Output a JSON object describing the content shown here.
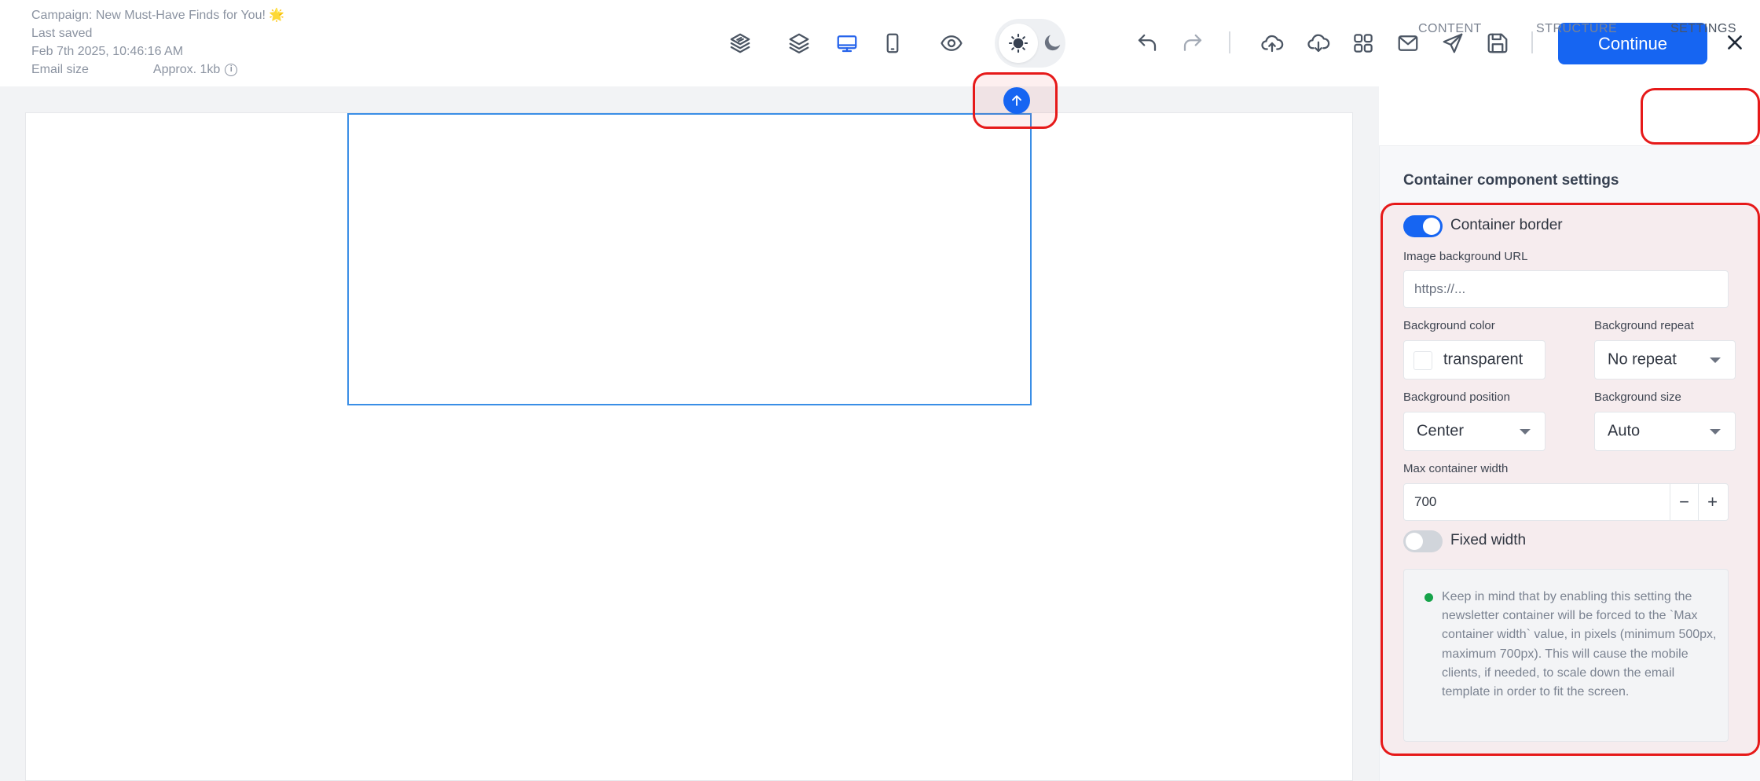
{
  "header": {
    "campaign_title": "Campaign: New Must-Have Finds for You! 🌟",
    "last_saved_label": "Last saved",
    "last_saved_time": "Feb 7th 2025, 10:46:16 AM",
    "email_size_label": "Email size",
    "email_size_value": "Approx. 1kb",
    "info_glyph": "i",
    "continue_label": "Continue",
    "close_glyph": "✕"
  },
  "toolbar_icons": [
    "layers-stack-icon",
    "layers-icon",
    "desktop-view-icon",
    "mobile-view-icon",
    "preview-eye-icon",
    "light-mode-icon",
    "dark-mode-icon",
    "undo-icon",
    "redo-icon",
    "upload-icon",
    "download-icon",
    "apps-grid-icon",
    "email-icon",
    "send-icon",
    "save-icon"
  ],
  "active_view": "desktop",
  "tabs": {
    "content": "CONTENT",
    "structure": "STRUCTURE",
    "settings": "SETTINGS",
    "active": "settings"
  },
  "settings": {
    "section_title": "Container component settings",
    "container_border_label": "Container border",
    "container_border_on": true,
    "image_bg_url_label": "Image background URL",
    "image_bg_url_placeholder": "https://...",
    "bg_color_label": "Background color",
    "bg_color_value": "transparent",
    "bg_repeat_label": "Background repeat",
    "bg_repeat_value": "No repeat",
    "bg_position_label": "Background position",
    "bg_position_value": "Center",
    "bg_size_label": "Background size",
    "bg_size_value": "Auto",
    "max_width_label": "Max container width",
    "max_width_value": "700",
    "minus": "−",
    "plus": "+",
    "fixed_width_label": "Fixed width",
    "fixed_width_on": false,
    "note": "Keep in mind that by enabling this setting the newsletter container will be forced to the `Max container width` value, in pixels (minimum 500px, maximum 700px). This will cause the mobile clients, if needed, to scale down the email template in order to fit the screen."
  },
  "colors": {
    "accent": "#1665f2",
    "selection_border": "#3a8ee6",
    "highlight": "#e61919",
    "note_dot": "#16a34a"
  }
}
